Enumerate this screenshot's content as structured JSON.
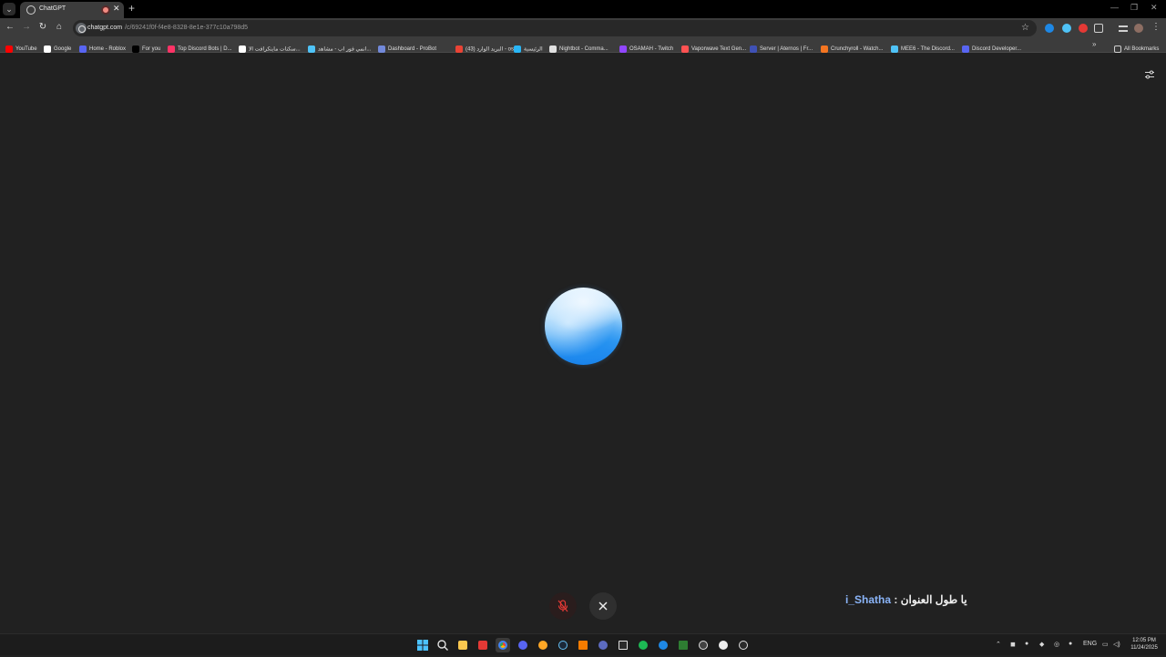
{
  "browser": {
    "tab": {
      "title": "ChatGPT"
    },
    "url": {
      "host": "chatgpt.com",
      "path": "/c/69241f0f-f4e8-8328-8e1e-377c10a798d5"
    }
  },
  "bookmarks": [
    {
      "label": "YouTube",
      "icon": "youtube-icon",
      "color": "#ff0000"
    },
    {
      "label": "Google",
      "icon": "google-icon",
      "color": "#ffffff"
    },
    {
      "label": "Home - Roblox",
      "icon": "roblox-icon",
      "color": "#5865f2"
    },
    {
      "label": "For you",
      "icon": "x-icon",
      "color": "#000000"
    },
    {
      "label": "Top Discord Bots | D...",
      "icon": "topgg-icon",
      "color": "#ff3366"
    },
    {
      "label": "سكنات ماينكرافت الا...",
      "icon": "n-icon",
      "color": "#ffffff"
    },
    {
      "label": "انمي فور اب - مشاهد...",
      "icon": "anime-icon",
      "color": "#4fc3f7"
    },
    {
      "label": "Dashboard - ProBot",
      "icon": "probot-icon",
      "color": "#7289da"
    },
    {
      "label": "(43) البريد الوارد - os...",
      "icon": "gmail-icon",
      "color": "#ea4335"
    },
    {
      "label": "الرئيسية",
      "icon": "home-bookmark-icon",
      "color": "#29b6f6"
    },
    {
      "label": "Nightbot - Comma...",
      "icon": "nightbot-icon",
      "color": "#e0e0e0"
    },
    {
      "label": "OSAMAH - Twitch",
      "icon": "twitch-icon",
      "color": "#9146ff"
    },
    {
      "label": "Vaporwave Text Gen...",
      "icon": "vaporwave-icon",
      "color": "#ff5252"
    },
    {
      "label": "Server | Aternos | Fr...",
      "icon": "aternos-icon",
      "color": "#3f51b5"
    },
    {
      "label": "Crunchyroll - Watch...",
      "icon": "crunchyroll-icon",
      "color": "#f47521"
    },
    {
      "label": "MEE6 - The Discord...",
      "icon": "mee6-icon",
      "color": "#4fc3f7"
    },
    {
      "label": "Discord Developer...",
      "icon": "discord-icon",
      "color": "#5865f2"
    }
  ],
  "all_bookmarks_label": "All Bookmarks",
  "overlay": {
    "username": "i_Shatha",
    "separator": " : ",
    "arabic_text": "يا طول العنوان"
  },
  "taskbar": {
    "language": "ENG",
    "time": "12:05 PM",
    "date": "11/24/2025"
  },
  "colors": {
    "page_bg": "#212121",
    "orb_blue": "#1478e6",
    "mic_muted": "#e53935"
  }
}
